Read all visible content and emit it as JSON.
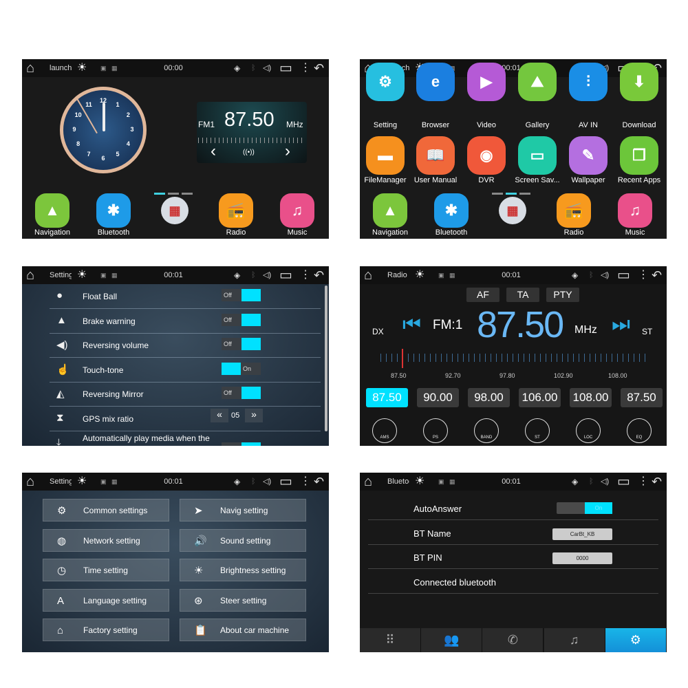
{
  "status_icons": [
    "home-icon",
    "brightness-icon",
    "gps-icon",
    "bluetooth-icon",
    "volume-icon",
    "window-icon",
    "menu-dots-icon",
    "back-icon"
  ],
  "panels": [
    {
      "title": "launch",
      "time": "00:00"
    },
    {
      "title": "launch",
      "time": "00:01"
    },
    {
      "title": "Settings",
      "time": "00:01"
    },
    {
      "title": "Radio",
      "time": "00:01"
    },
    {
      "title": "Settings",
      "time": "00:01"
    },
    {
      "title": "Bluetooth",
      "time": "00:01"
    }
  ],
  "home": {
    "clock_numbers": [
      "12",
      "1",
      "2",
      "3",
      "4",
      "5",
      "6",
      "7",
      "8",
      "9",
      "10",
      "11"
    ],
    "radio": {
      "band": "FM1",
      "freq": "87.50",
      "unit": "MHz"
    },
    "page": 1,
    "pages": 3
  },
  "dock": [
    {
      "label": "Navigation",
      "color": "#7cc63c",
      "glyph": "▲"
    },
    {
      "label": "Bluetooth",
      "color": "#1e9be8",
      "glyph": "✱"
    },
    {
      "label": "",
      "color": "#d8dde4",
      "glyph": "▦"
    },
    {
      "label": "Radio",
      "color": "#f79a1e",
      "glyph": "📻"
    },
    {
      "label": "Music",
      "color": "#e9508a",
      "glyph": "♫"
    }
  ],
  "apps": {
    "page": 2,
    "items": [
      {
        "label": "Setting",
        "color": "#26bfe0",
        "glyph": "⚙"
      },
      {
        "label": "Browser",
        "color": "#1b7fe0",
        "glyph": "e"
      },
      {
        "label": "Video",
        "color": "#b55ad6",
        "glyph": "▶"
      },
      {
        "label": "Gallery",
        "color": "#74c73e",
        "glyph": "⛰"
      },
      {
        "label": "AV IN",
        "color": "#1a8ee6",
        "glyph": "⫶"
      },
      {
        "label": "Download",
        "color": "#79c93a",
        "glyph": "⬇"
      },
      {
        "label": "FileManager",
        "color": "#f5901e",
        "glyph": "▬"
      },
      {
        "label": "User Manual",
        "color": "#f0683a",
        "glyph": "📖"
      },
      {
        "label": "DVR",
        "color": "#f0583a",
        "glyph": "◉"
      },
      {
        "label": "Screen Sav...",
        "color": "#1fc9a6",
        "glyph": "▭"
      },
      {
        "label": "Wallpaper",
        "color": "#b46fe0",
        "glyph": "✎"
      },
      {
        "label": "Recent Apps",
        "color": "#6cc63a",
        "glyph": "❐"
      }
    ]
  },
  "settings_list": [
    {
      "label": "Float Ball",
      "icon": "float-ball-icon",
      "glyph": "●",
      "type": "toggle",
      "state": "Off"
    },
    {
      "label": "Brake warning",
      "icon": "warning-icon",
      "glyph": "▲",
      "type": "toggle",
      "state": "Off"
    },
    {
      "label": "Reversing volume",
      "icon": "speaker-icon",
      "glyph": "◀)",
      "type": "toggle",
      "state": "Off"
    },
    {
      "label": "Touch-tone",
      "icon": "touch-icon",
      "glyph": "☝",
      "type": "toggle",
      "state": "On"
    },
    {
      "label": "Reversing Mirror",
      "icon": "mirror-icon",
      "glyph": "◭",
      "type": "toggle",
      "state": "Off"
    },
    {
      "label": "GPS mix ratio",
      "icon": "hourglass-icon",
      "glyph": "⧗",
      "type": "stepper",
      "value": "05"
    },
    {
      "label": "Automatically play media when the",
      "icon": "auto-play-icon",
      "glyph": "⤓",
      "type": "toggle",
      "state": "Off"
    }
  ],
  "radio": {
    "buttons": [
      "AF",
      "TA",
      "PTY"
    ],
    "dx": "DX",
    "band": "FM:1",
    "freq": "87.50",
    "unit": "MHz",
    "st": "ST",
    "scale": [
      "87.50",
      "92.70",
      "97.80",
      "102.90",
      "108.00"
    ],
    "presets": [
      "87.50",
      "90.00",
      "98.00",
      "106.00",
      "108.00",
      "87.50"
    ],
    "active_preset": 0,
    "functions": [
      {
        "label": "AMS",
        "icon": "ams-icon"
      },
      {
        "label": "PS",
        "icon": "ps-icon"
      },
      {
        "label": "BAND",
        "icon": "band-icon"
      },
      {
        "label": "ST",
        "icon": "stereo-icon"
      },
      {
        "label": "LOC",
        "icon": "loc-icon"
      },
      {
        "label": "EQ",
        "icon": "eq-icon"
      }
    ]
  },
  "settings_menu": [
    {
      "label": "Common settings",
      "glyph": "⚙"
    },
    {
      "label": "Navig setting",
      "glyph": "➤"
    },
    {
      "label": "Network setting",
      "glyph": "◍"
    },
    {
      "label": "Sound setting",
      "glyph": "🔊"
    },
    {
      "label": "Time setting",
      "glyph": "◷"
    },
    {
      "label": "Brightness setting",
      "glyph": "☀"
    },
    {
      "label": "Language setting",
      "glyph": "A"
    },
    {
      "label": "Steer setting",
      "glyph": "⊛"
    },
    {
      "label": "Factory setting",
      "glyph": "⌂"
    },
    {
      "label": "About car machine",
      "glyph": "📋"
    }
  ],
  "bluetooth": {
    "auto_answer": {
      "label": "AutoAnswer",
      "state": "On"
    },
    "name": {
      "label": "BT Name",
      "value": "CarBt_KB"
    },
    "pin": {
      "label": "BT PIN",
      "value": "0000"
    },
    "connected": "Connected bluetooth",
    "tabs": [
      {
        "icon": "dialpad-icon",
        "glyph": "⠿"
      },
      {
        "icon": "contacts-icon",
        "glyph": "👥"
      },
      {
        "icon": "call-log-icon",
        "glyph": "✆"
      },
      {
        "icon": "bt-music-icon",
        "glyph": "♫"
      },
      {
        "icon": "bt-settings-icon",
        "glyph": "⚙"
      }
    ],
    "active_tab": 4
  },
  "colors": {
    "accent": "#00e1ff",
    "freq_blue": "#6ab8f5"
  }
}
